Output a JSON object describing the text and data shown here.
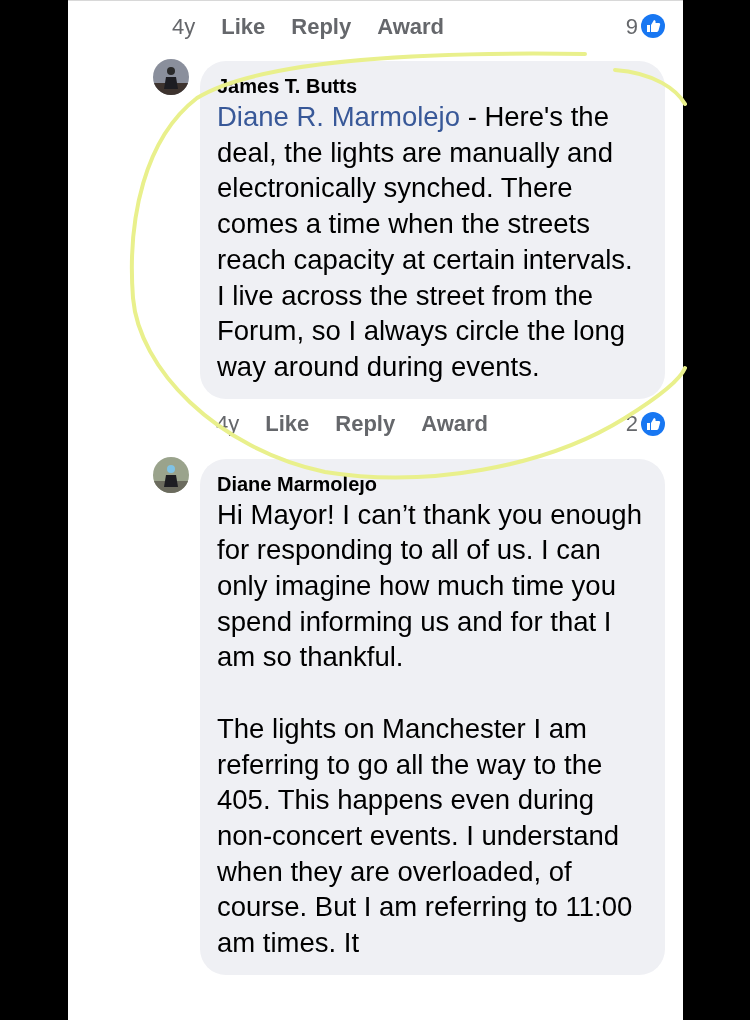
{
  "previous_comment_footer": {
    "time": "4y",
    "actions": [
      "Like",
      "Reply",
      "Award"
    ],
    "reaction_count": "9"
  },
  "comments": [
    {
      "author": "James T. Butts",
      "mention": "Diane R. Marmolejo",
      "paragraphs": [
        " - Here's the deal, the lights are manually and electronically synched.  There comes a time when the streets reach capacity at certain intervals.  I live across the street from the Forum, so I always circle the long way around during events."
      ],
      "footer": {
        "time": "4y",
        "actions": [
          "Like",
          "Reply",
          "Award"
        ],
        "reaction_count": "2"
      }
    },
    {
      "author": "Diane Marmolejo",
      "paragraphs": [
        "Hi Mayor! I can’t thank you enough for responding to all of us. I can only imagine how much time you spend informing us and for that I am so thankful.",
        "The lights on Manchester I am referring to go all the way to the 405. This happens even during non-concert events. I understand when they are overloaded, of course. But I am referring to 11:00 am times. It"
      ]
    }
  ]
}
